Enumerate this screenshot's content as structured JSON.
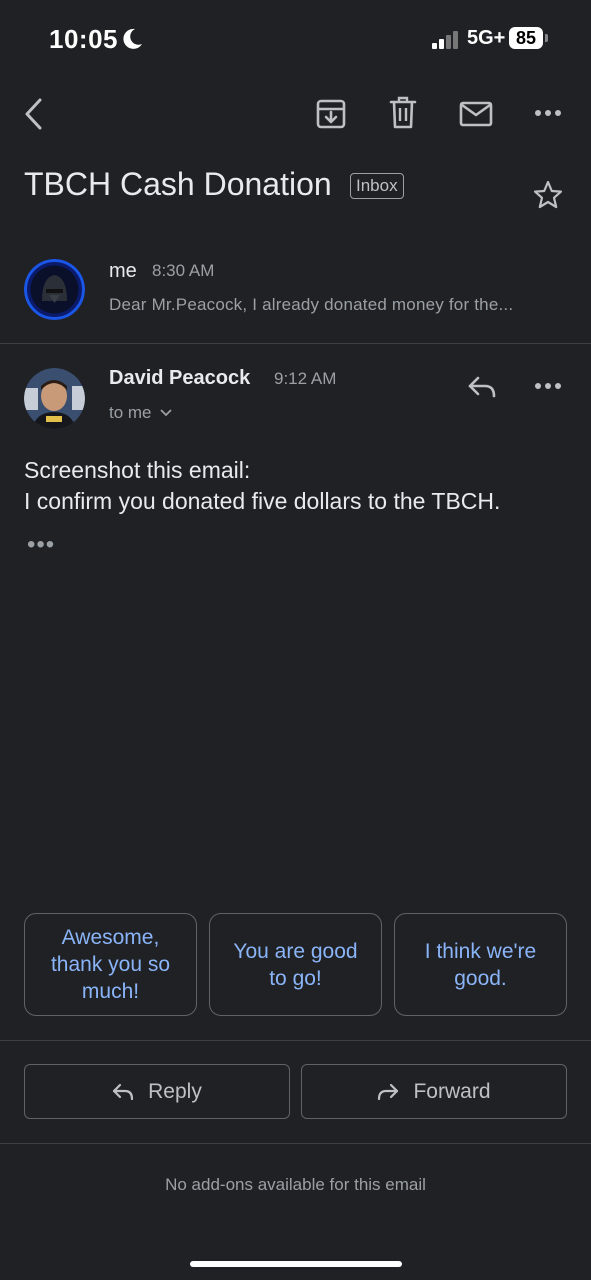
{
  "status_bar": {
    "time": "10:05",
    "network": "5G+",
    "battery": "85"
  },
  "toolbar": {
    "icons": [
      "back-arrow-icon",
      "archive-icon",
      "trash-icon",
      "mail-icon",
      "more-icon"
    ]
  },
  "email": {
    "subject": "TBCH Cash Donation",
    "label": "Inbox"
  },
  "messages": [
    {
      "sender": "me",
      "time": "8:30 AM",
      "snippet": "Dear Mr.Peacock, I already donated money for the..."
    },
    {
      "sender": "David Peacock",
      "time": "9:12 AM",
      "recipient": "to me",
      "body_lines": [
        "Screenshot this email:",
        "I confirm you donated five dollars to the TBCH."
      ],
      "collapsed_indicator": "•••"
    }
  ],
  "smart_replies": [
    "Awesome, thank you so much!",
    "You are good to go!",
    "I think we're good."
  ],
  "actions": {
    "reply": "Reply",
    "forward": "Forward"
  },
  "footer": {
    "addons": "No add-ons available for this email"
  },
  "colors": {
    "background": "#202124",
    "accent": "#8ab4f8",
    "avatar_ring": "#1a56e8"
  }
}
